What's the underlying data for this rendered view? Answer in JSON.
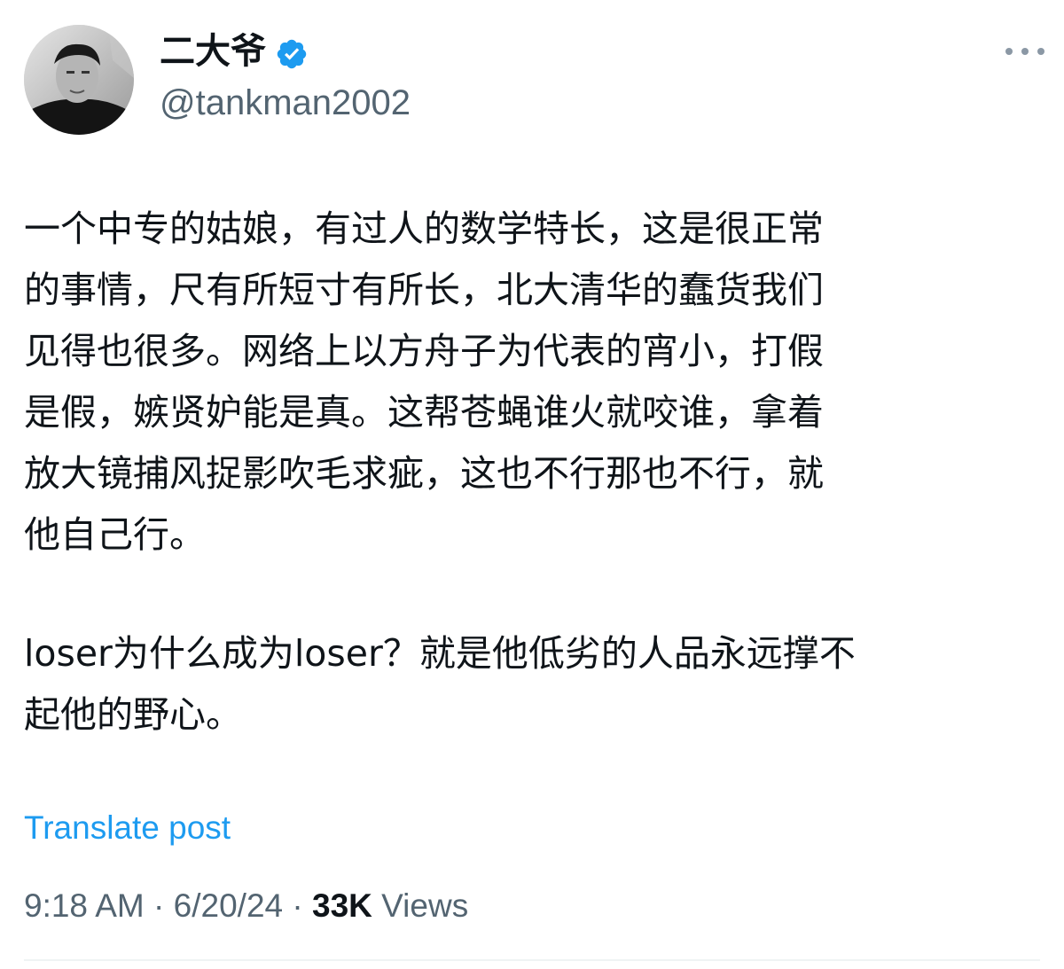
{
  "author": {
    "display_name": "二大爷",
    "handle": "@tankman2002",
    "verified": true,
    "avatar_icon": "avatar-photo"
  },
  "post": {
    "paragraph_1": "一个中专的姑娘，有过人的数学特长，这是很正常\n的事情，尺有所短寸有所长，北大清华的蠢货我们\n见得也很多。网络上以方舟子为代表的宵小，打假\n是假，嫉贤妒能是真。这帮苍蝇谁火就咬谁，拿着\n放大镜捕风捉影吹毛求疵，这也不行那也不行，就\n他自己行。",
    "paragraph_2": "loser为什么成为loser？就是他低劣的人品永远撑不\n起他的野心。"
  },
  "translate_label": "Translate post",
  "meta": {
    "time": "9:18 AM",
    "separator": " · ",
    "date": "6/20/24",
    "views_count": "33K",
    "views_label": " Views"
  },
  "colors": {
    "accent": "#1d9bf0",
    "secondary_text": "#536471",
    "primary_text": "#0f1419"
  },
  "icons": {
    "verified": "verified-badge-icon",
    "more": "more-options-icon"
  }
}
